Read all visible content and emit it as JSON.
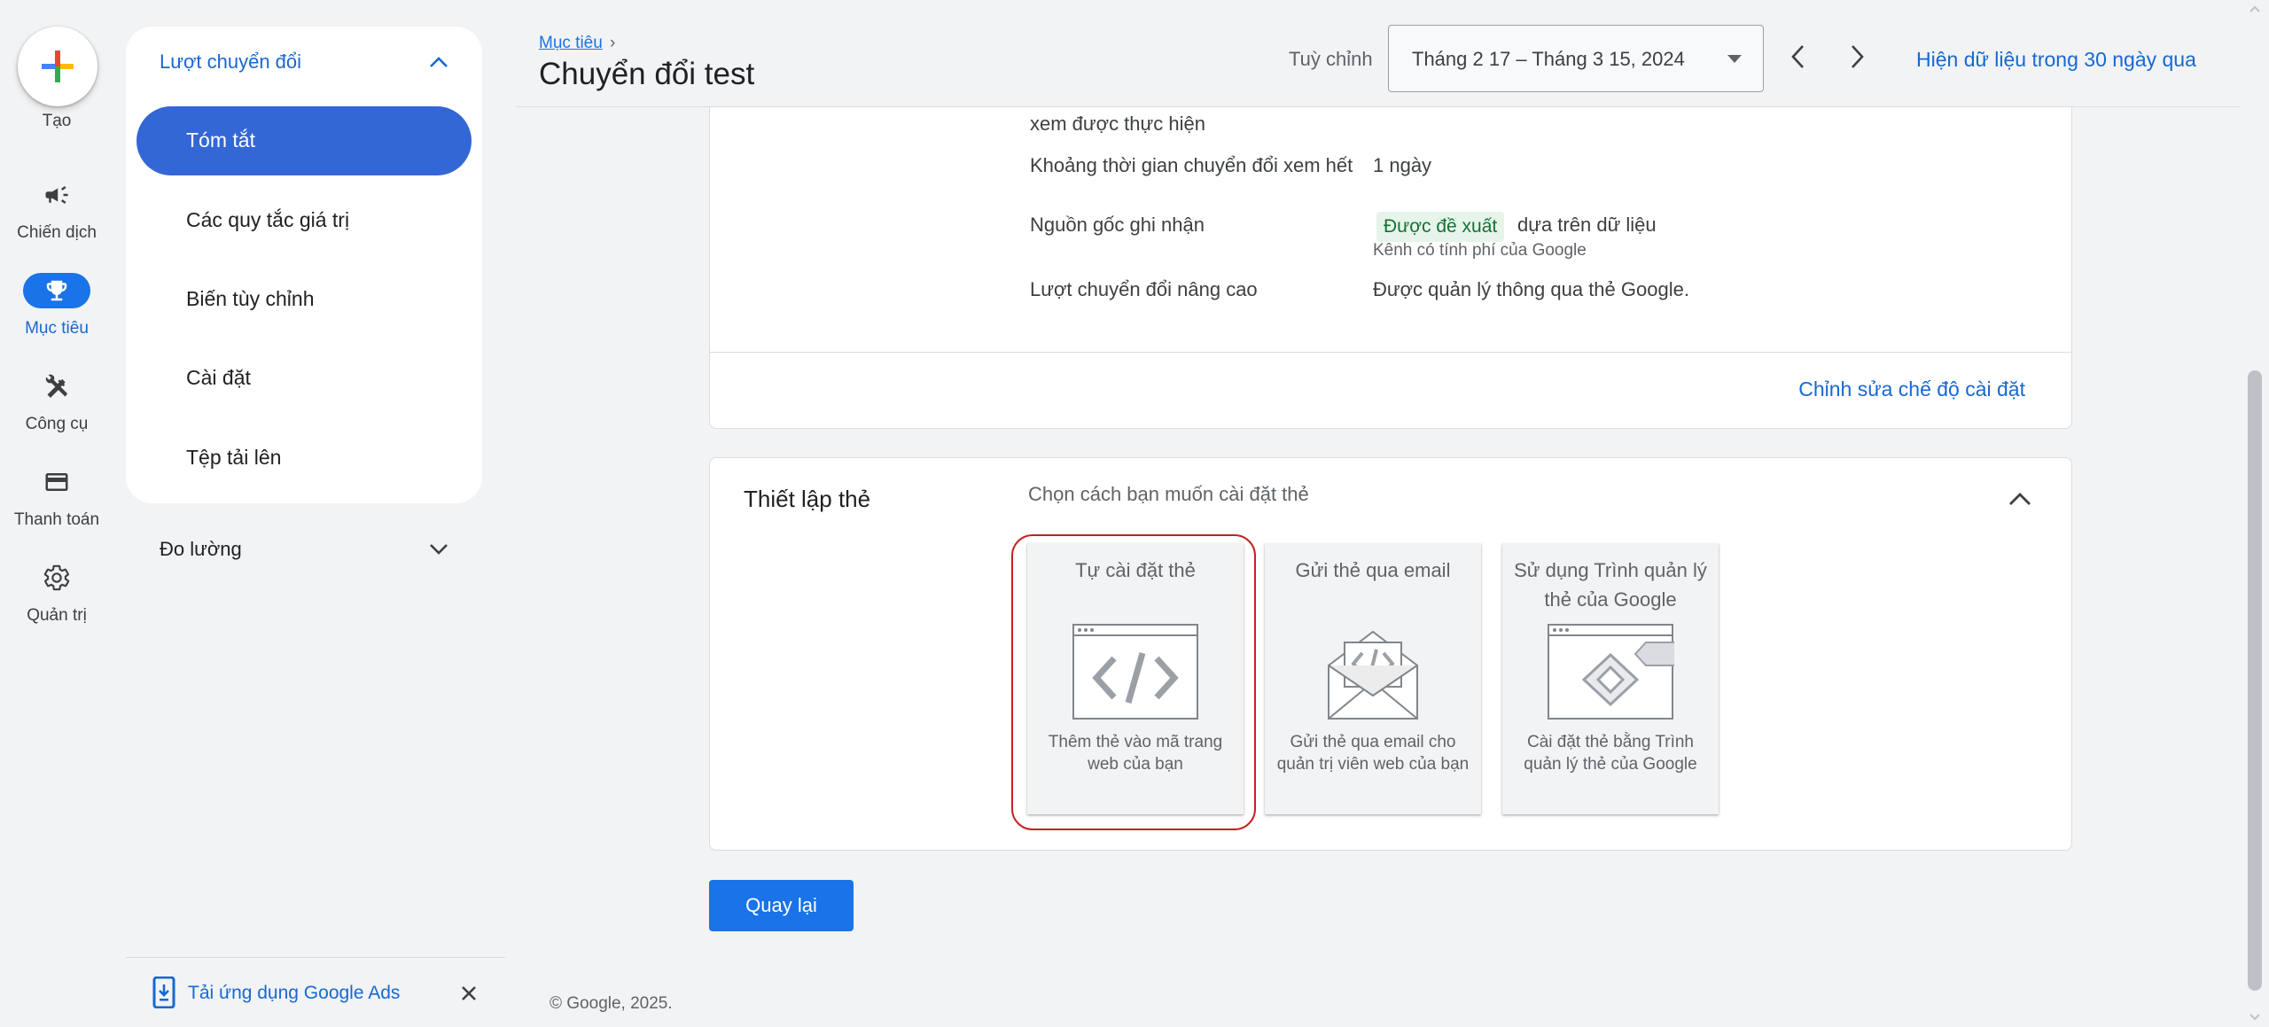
{
  "rail": {
    "create_label": "Tạo",
    "items": [
      {
        "label": "Chiến dịch",
        "icon": "megaphone-icon"
      },
      {
        "label": "Mục tiêu",
        "icon": "trophy-icon"
      },
      {
        "label": "Công cụ",
        "icon": "tools-icon"
      },
      {
        "label": "Thanh toán",
        "icon": "credit-card-icon"
      },
      {
        "label": "Quản trị",
        "icon": "gear-icon"
      }
    ]
  },
  "subnav": {
    "section": "Lượt chuyển đổi",
    "items": [
      {
        "label": "Tóm tắt"
      },
      {
        "label": "Các quy tắc giá trị"
      },
      {
        "label": "Biến tùy chỉnh"
      },
      {
        "label": "Cài đặt"
      },
      {
        "label": "Tệp tải lên"
      }
    ],
    "measure": "Đo lường",
    "app_promo": "Tải ứng dụng Google Ads"
  },
  "header": {
    "breadcrumb": "Mục tiêu",
    "breadcrumb_sep": "›",
    "title": "Chuyển đổi test",
    "custom_label": "Tuỳ chỉnh",
    "date_range": "Tháng 2 17 – Tháng 3 15, 2024",
    "last30": "Hiện dữ liệu trong 30 ngày qua"
  },
  "settings": {
    "row0_label": "xem được thực hiện",
    "row1_label": "Khoảng thời gian chuyển đổi xem hết",
    "row1_value": "1 ngày",
    "row2_label": "Nguồn gốc ghi nhận",
    "row2_badge": "Được đề xuất",
    "row2_value": "dựa trên dữ liệu",
    "row2_note": "Kênh có tính phí của Google",
    "row3_label": "Lượt chuyển đổi nâng cao",
    "row3_value": "Được quản lý thông qua thẻ Google.",
    "edit_link": "Chỉnh sửa chế độ cài đặt"
  },
  "tag_setup": {
    "title": "Thiết lập thẻ",
    "hint": "Chọn cách bạn muốn cài đặt thẻ",
    "options": [
      {
        "title": "Tự cài đặt thẻ",
        "desc": "Thêm thẻ vào mã trang web của bạn",
        "icon": "code-browser-icon"
      },
      {
        "title": "Gửi thẻ qua email",
        "desc": "Gửi thẻ qua email cho quản trị viên web của bạn",
        "icon": "code-envelope-icon"
      },
      {
        "title": "Sử dụng Trình quản lý thẻ của Google",
        "desc": "Cài đặt thẻ bằng Trình quản lý thẻ của Google",
        "icon": "tag-manager-icon"
      }
    ]
  },
  "back_button": "Quay lại",
  "footer": "© Google, 2025.",
  "colors": {
    "accent": "#1a73e8",
    "active_nav": "#3367d6",
    "highlight": "#c5221f",
    "badge_bg": "#e6f4ea"
  }
}
